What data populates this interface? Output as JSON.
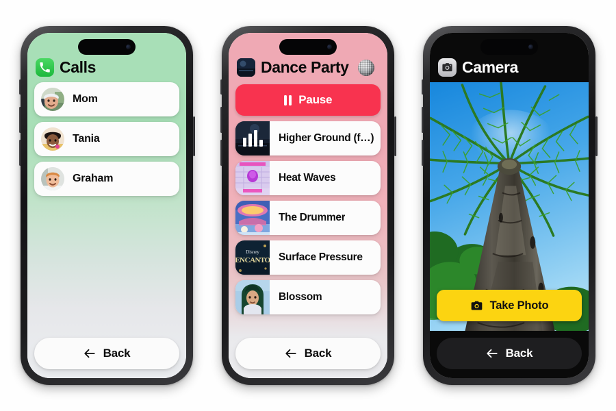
{
  "page": {
    "background": "#fefefe",
    "device_count": 3
  },
  "phones": [
    {
      "id": "calls",
      "theme_color": "#a8dfb7",
      "header": {
        "icon": "phone-icon",
        "title": "Calls"
      },
      "contacts": [
        {
          "name": "Mom",
          "avatar": "photo-mom"
        },
        {
          "name": "Tania",
          "avatar": "photo-tania"
        },
        {
          "name": "Graham",
          "avatar": "photo-graham"
        }
      ],
      "back": {
        "label": "Back",
        "icon": "arrow-left-icon"
      }
    },
    {
      "id": "music",
      "theme_color": "#efa9b4",
      "header": {
        "icon": "album-art-icon",
        "title": "Dance Party",
        "trailing_icon": "disco-ball-icon"
      },
      "transport": {
        "label": "Pause",
        "icon": "pause-icon",
        "color": "#f8334f"
      },
      "songs": [
        {
          "title": "Higher Ground (f…)",
          "art": "art-nightscape",
          "now_playing": true
        },
        {
          "title": "Heat Waves",
          "art": "art-heat-waves",
          "now_playing": false
        },
        {
          "title": "The Drummer",
          "art": "art-the-drummer",
          "now_playing": false
        },
        {
          "title": "Surface Pressure",
          "art": "art-encanto",
          "now_playing": false
        },
        {
          "title": "Blossom",
          "art": "art-blossom",
          "now_playing": false
        }
      ],
      "back": {
        "label": "Back",
        "icon": "arrow-left-icon"
      }
    },
    {
      "id": "camera",
      "theme_color": "#0a0a0a",
      "header": {
        "icon": "camera-icon",
        "title": "Camera"
      },
      "viewfinder": {
        "scene": "palm-tree-from-below"
      },
      "shutter": {
        "label": "Take Photo",
        "icon": "camera-icon",
        "color": "#fcd411"
      },
      "back": {
        "label": "Back",
        "icon": "arrow-left-icon"
      }
    }
  ]
}
